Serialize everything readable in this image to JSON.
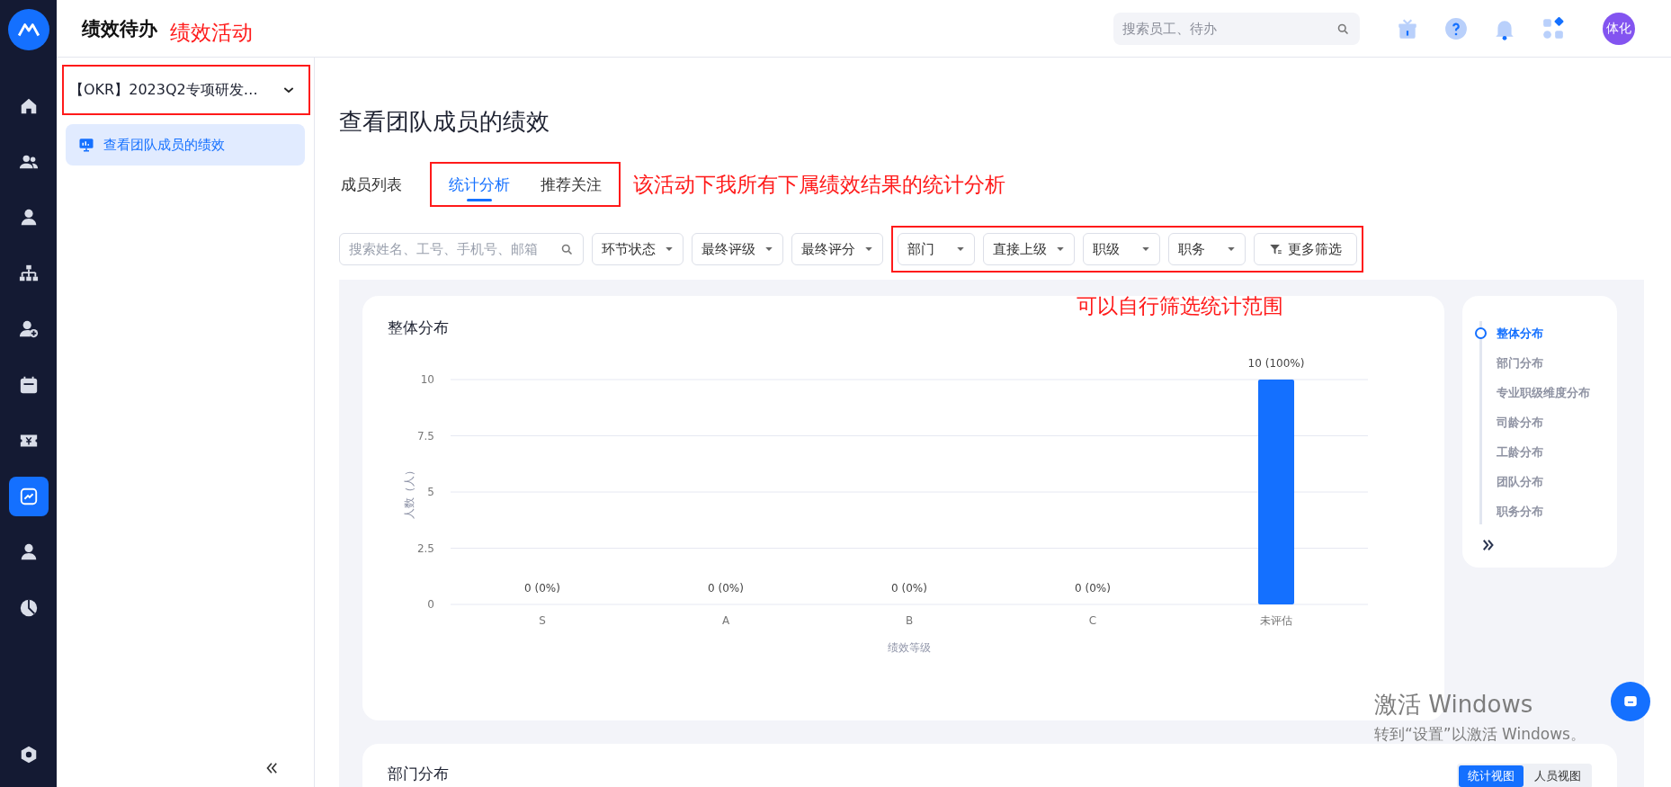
{
  "rail": {
    "items": [
      {
        "kind": "home",
        "selected": false
      },
      {
        "kind": "people",
        "selected": false
      },
      {
        "kind": "person",
        "selected": false
      },
      {
        "kind": "org",
        "selected": false
      },
      {
        "kind": "person-add",
        "selected": false
      },
      {
        "kind": "calendar",
        "selected": false
      },
      {
        "kind": "ticket",
        "selected": false
      },
      {
        "kind": "trend",
        "selected": true
      },
      {
        "kind": "person",
        "selected": false
      },
      {
        "kind": "pie",
        "selected": false
      }
    ]
  },
  "header": {
    "title": "绩效待办",
    "note": "绩效活动",
    "search": {
      "placeholder": "搜索员工、待办"
    },
    "avatar": "体化"
  },
  "activity_select": {
    "value": "【OKR】2023Q2专项研发…",
    "highlighted": true
  },
  "side_nav": [
    {
      "label": "查看团队成员的绩效",
      "selected": true
    }
  ],
  "page_title": "查看团队成员的绩效",
  "tab_groups": [
    {
      "highlighted": false,
      "tabs": [
        {
          "label": "成员列表",
          "selected": false
        }
      ]
    },
    {
      "highlighted": true,
      "tabs": [
        {
          "label": "统计分析",
          "selected": true
        },
        {
          "label": "推荐关注",
          "selected": false
        }
      ]
    }
  ],
  "tabs_note": "该活动下我所有下属绩效结果的统计分析",
  "filters": {
    "search": {
      "placeholder": "搜索姓名、工号、手机号、邮箱"
    },
    "groups": [
      {
        "highlighted": false,
        "items": [
          {
            "kind": "dropdown",
            "label": "环节状态"
          },
          {
            "kind": "dropdown",
            "label": "最终评级"
          },
          {
            "kind": "dropdown",
            "label": "最终评分"
          }
        ]
      },
      {
        "highlighted": true,
        "items": [
          {
            "kind": "dropdown",
            "label": "部门"
          },
          {
            "kind": "dropdown",
            "label": "直接上级"
          },
          {
            "kind": "dropdown",
            "label": "职级"
          },
          {
            "kind": "dropdown",
            "label": "职务"
          },
          {
            "kind": "more",
            "label": "更多筛选"
          }
        ]
      }
    ],
    "note": "可以自行筛选统计范围"
  },
  "chart_card": {
    "title": "整体分布",
    "chart_data": {
      "type": "bar",
      "xlabel": "绩效等级",
      "ylabel": "人数（人）",
      "categories": [
        "S",
        "A",
        "B",
        "C",
        "未评估"
      ],
      "values": [
        0,
        0,
        0,
        0,
        10
      ],
      "ylim": [
        0,
        10
      ],
      "yticks": [
        0,
        2.5,
        5,
        7.5,
        10
      ],
      "grid": true,
      "value_labels": [
        "0 (0%)",
        "0 (0%)",
        "0 (0%)",
        "0 (0%)",
        "10 (100%)"
      ]
    }
  },
  "anchor_nav": {
    "items": [
      {
        "label": "整体分布",
        "selected": true
      },
      {
        "label": "部门分布",
        "selected": false
      },
      {
        "label": "专业职级维度分布",
        "selected": false
      },
      {
        "label": "司龄分布",
        "selected": false
      },
      {
        "label": "工龄分布",
        "selected": false
      },
      {
        "label": "团队分布",
        "selected": false
      },
      {
        "label": "职务分布",
        "selected": false
      }
    ]
  },
  "dept_card": {
    "title": "部门分布",
    "views": [
      {
        "label": "统计视图",
        "selected": true
      },
      {
        "label": "人员视图",
        "selected": false
      }
    ]
  },
  "os_overlay": {
    "title": "激活 Windows",
    "subtitle": "转到“设置”以激活 Windows。"
  }
}
